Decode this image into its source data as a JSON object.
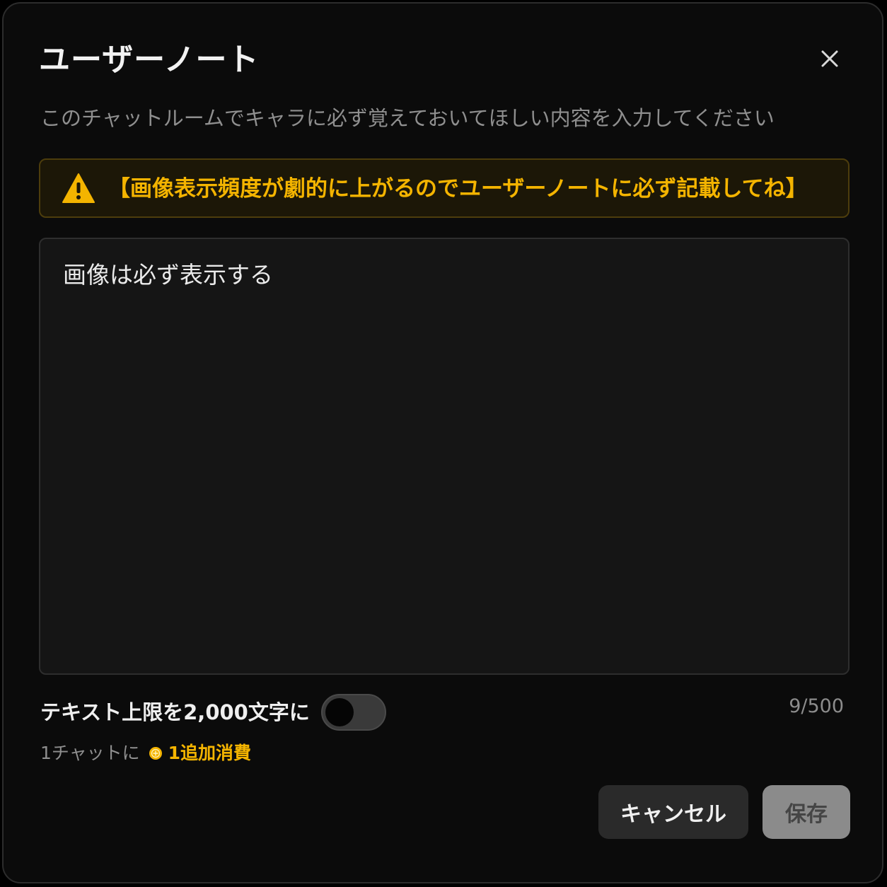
{
  "modal": {
    "title": "ユーザーノート",
    "description": "このチャットルームでキャラに必ず覚えておいてほしい内容を入力してください",
    "close_icon": "close-icon"
  },
  "warning": {
    "icon": "warning-triangle-icon",
    "text": "【画像表示頻度が劇的に上がるのでユーザーノートに必ず記載してね】",
    "color": "#f4b400"
  },
  "note": {
    "value": "画像は必ず表示する",
    "char_count": "9/500"
  },
  "text_limit": {
    "label": "テキスト上限を2,000文字に",
    "toggle_on": false
  },
  "cost": {
    "prefix": "1チャットに",
    "coin_icon": "coin-icon",
    "value": "1追加消費"
  },
  "buttons": {
    "cancel_label": "キャンセル",
    "save_label": "保存"
  }
}
